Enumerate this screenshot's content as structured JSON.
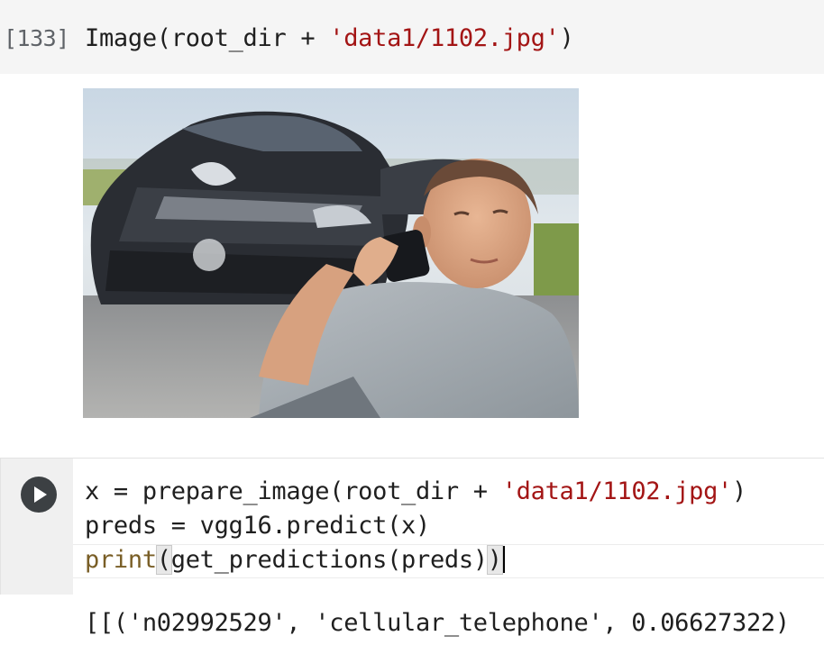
{
  "cells": [
    {
      "execution_count": "[133]",
      "code_line": {
        "fn": "Image",
        "open": "(",
        "arg": "root_dir + ",
        "string": "'data1/1102.jpg'",
        "close": ")"
      }
    },
    {
      "run_button_icon": "play-icon",
      "lines": [
        {
          "pre": "x = prepare_image(root_dir + ",
          "string": "'data1/1102.jpg'",
          "post": ")"
        },
        {
          "text": "preds = vgg16.predict(x)"
        },
        {
          "print_kw": "print",
          "open": "(",
          "body": "get_predictions(preds)",
          "close": ")"
        }
      ],
      "output": "[[('n02992529', 'cellular_telephone', 0.06627322)"
    }
  ],
  "output_image": {
    "subject": "man on phone in front of crashed car"
  },
  "colors": {
    "string": "#a31515",
    "builtin": "#795e26",
    "cell_bg": "#f5f5f5",
    "run_button": "#3c4043"
  }
}
